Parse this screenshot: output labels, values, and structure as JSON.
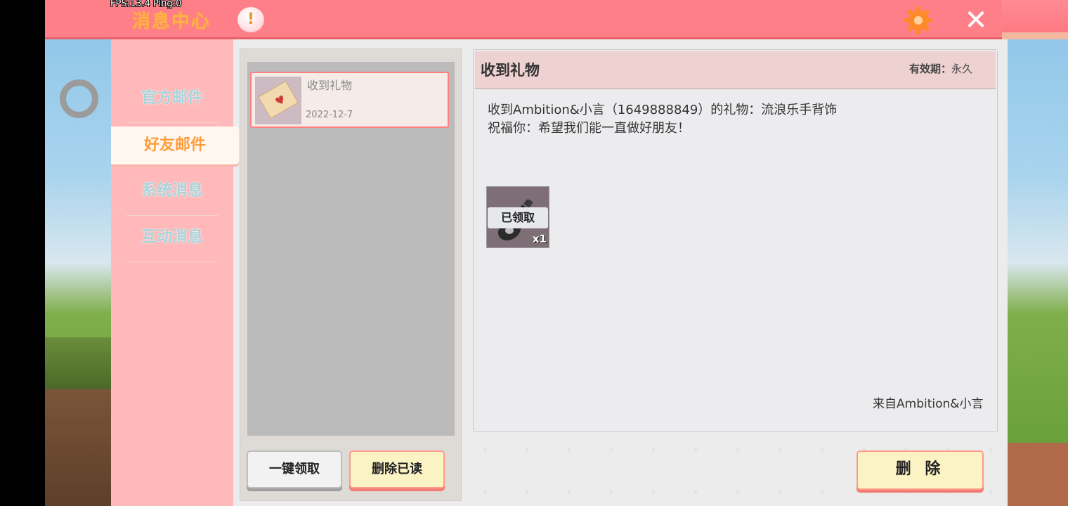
{
  "debug": {
    "fps_text": "FPS:13.4  Ping:0"
  },
  "header": {
    "title": "消息中心",
    "alert_symbol": "!",
    "close_symbol": "✕",
    "icons": [
      "alert-icon",
      "gear-icon",
      "close-icon"
    ]
  },
  "sidebar": {
    "items": [
      {
        "label": "官方邮件",
        "active": false
      },
      {
        "label": "好友邮件",
        "active": true
      },
      {
        "label": "系统消息",
        "active": false
      },
      {
        "label": "互动消息",
        "active": false
      }
    ]
  },
  "mail_list": {
    "items": [
      {
        "title": "收到礼物",
        "date": "2022-12-7",
        "icon": "envelope-icon"
      }
    ],
    "claim_all_label": "一键领取",
    "delete_read_label": "删除已读"
  },
  "detail": {
    "title": "收到礼物",
    "validity_label": "有效期：",
    "validity_value": "永久",
    "body_line1": "收到Ambition&小言（1649888849）的礼物：流浪乐手背饰",
    "body_line2": "祝福你：希望我们能一直做好朋友！",
    "attachment": {
      "status": "已领取",
      "quantity": "x1",
      "icon": "guitar-icon"
    },
    "sender": "来自Ambition&小言",
    "delete_label": "删 除"
  },
  "colors": {
    "header_pink": "#ff7f88",
    "sidebar_pink": "#ffb9ba",
    "active_orange": "#ff9d3a",
    "inactive_teal": "#a6d5dc",
    "button_cream": "#fbf3c4"
  }
}
